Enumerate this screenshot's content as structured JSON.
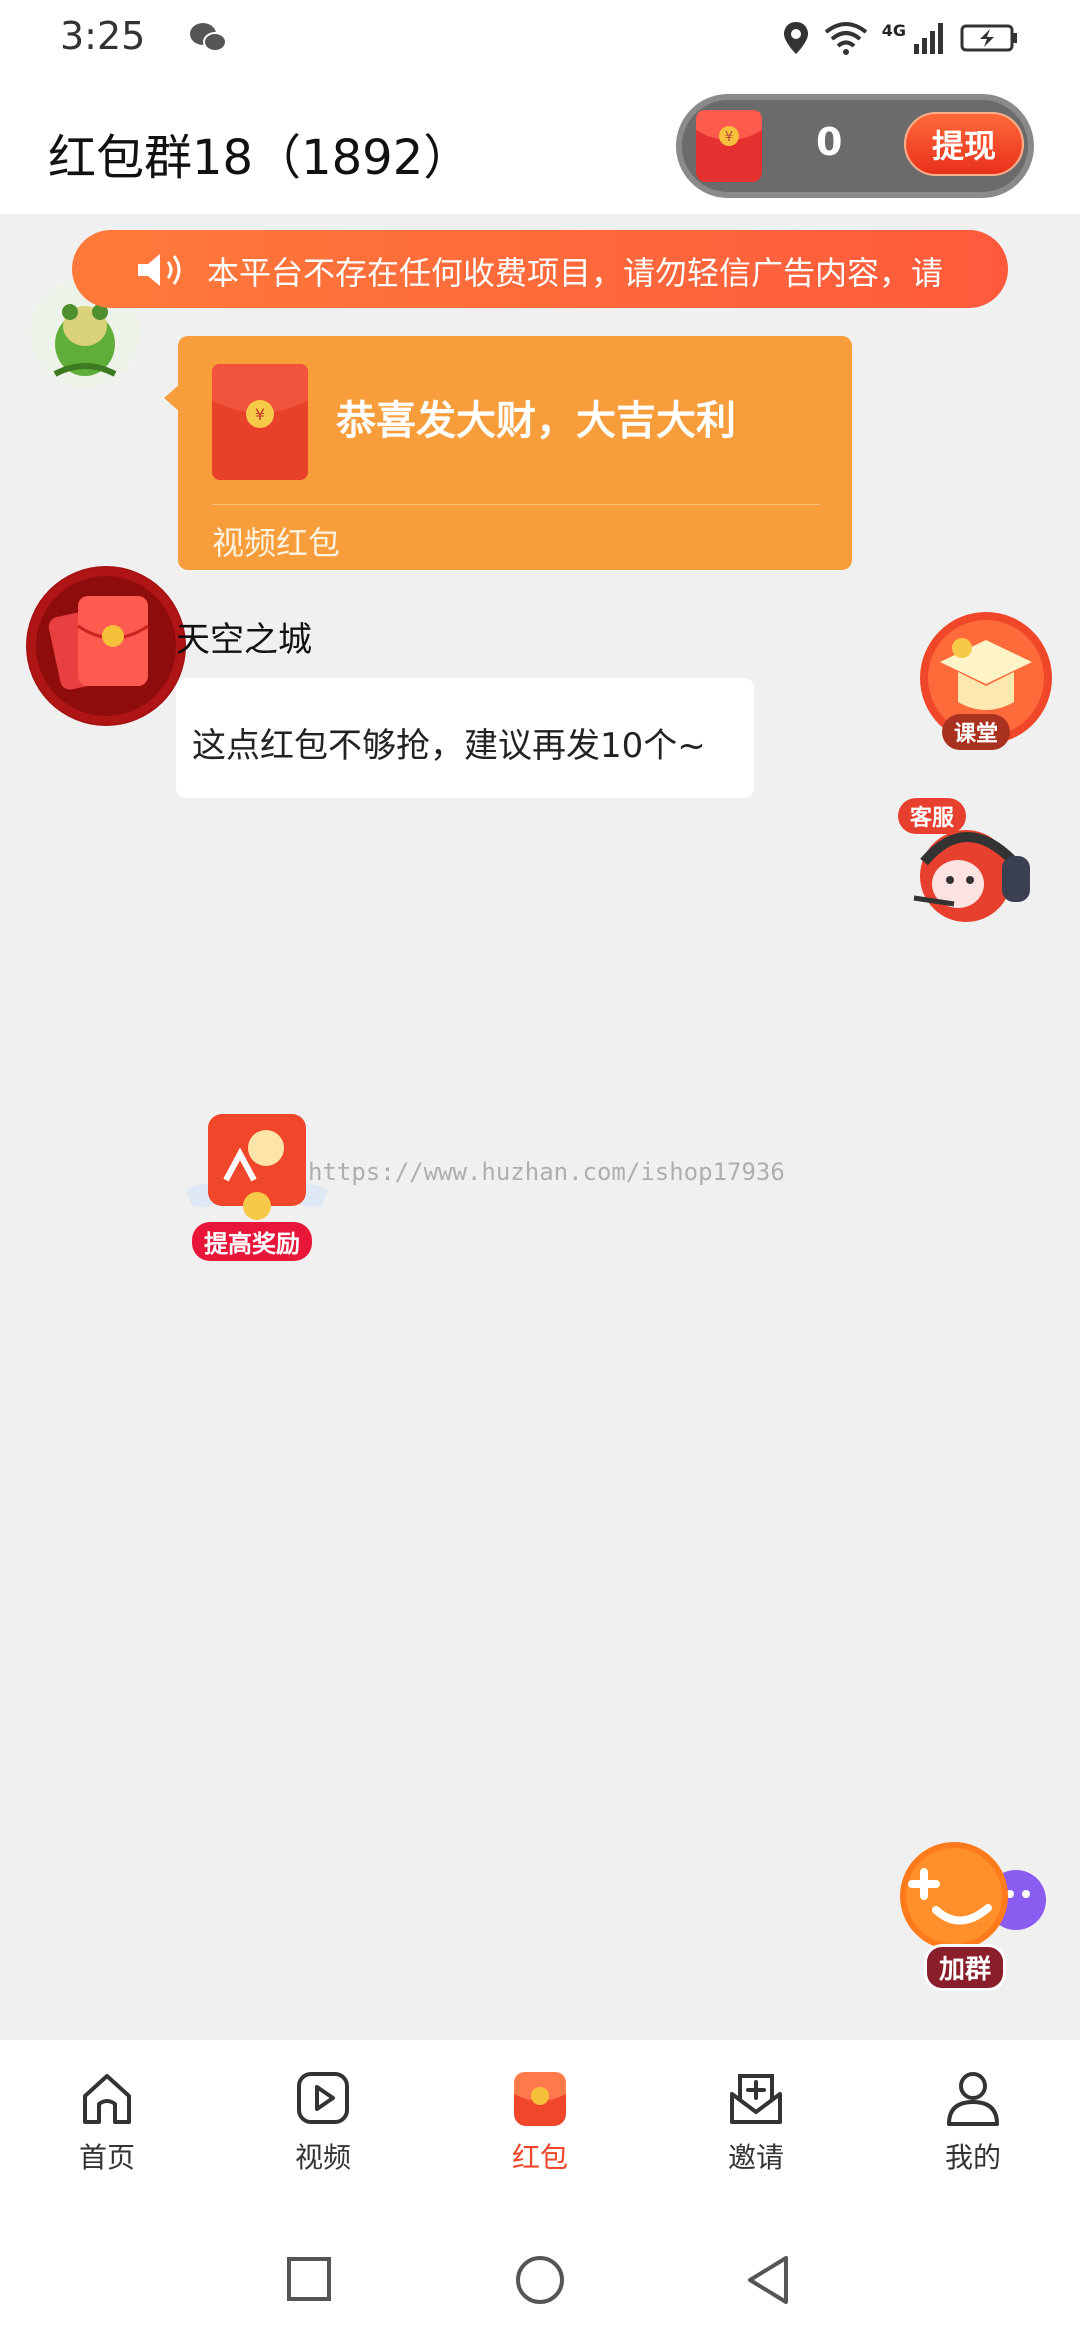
{
  "status_bar": {
    "time": "3:25",
    "network": "4G"
  },
  "header": {
    "title": "红包群18（1892）",
    "wallet_balance": "0",
    "withdraw_label": "提现"
  },
  "notice": {
    "text": "本平台不存在任何收费项目，请勿轻信广告内容，请"
  },
  "messages": [
    {
      "type": "red_packet",
      "title": "恭喜发大财，大吉大利",
      "footer": "视频红包"
    },
    {
      "type": "text",
      "sender": "天空之城",
      "text": "这点红包不够抢，建议再发10个~"
    }
  ],
  "floating": {
    "class_label": "课堂",
    "service_label": "客服",
    "reward_label": "提高奖励",
    "join_label": "加群"
  },
  "watermark": "https://www.huzhan.com/ishop17936",
  "tabs": [
    {
      "label": "首页",
      "icon": "home-icon",
      "active": false
    },
    {
      "label": "视频",
      "icon": "video-icon",
      "active": false
    },
    {
      "label": "红包",
      "icon": "red-packet-icon",
      "active": true
    },
    {
      "label": "邀请",
      "icon": "invite-icon",
      "active": false
    },
    {
      "label": "我的",
      "icon": "profile-icon",
      "active": false
    }
  ],
  "colors": {
    "accent": "#f0462a",
    "notice_bg": "#ff6a3a",
    "packet_bg": "#f79d3b",
    "page_bg": "#f0f0f0"
  }
}
